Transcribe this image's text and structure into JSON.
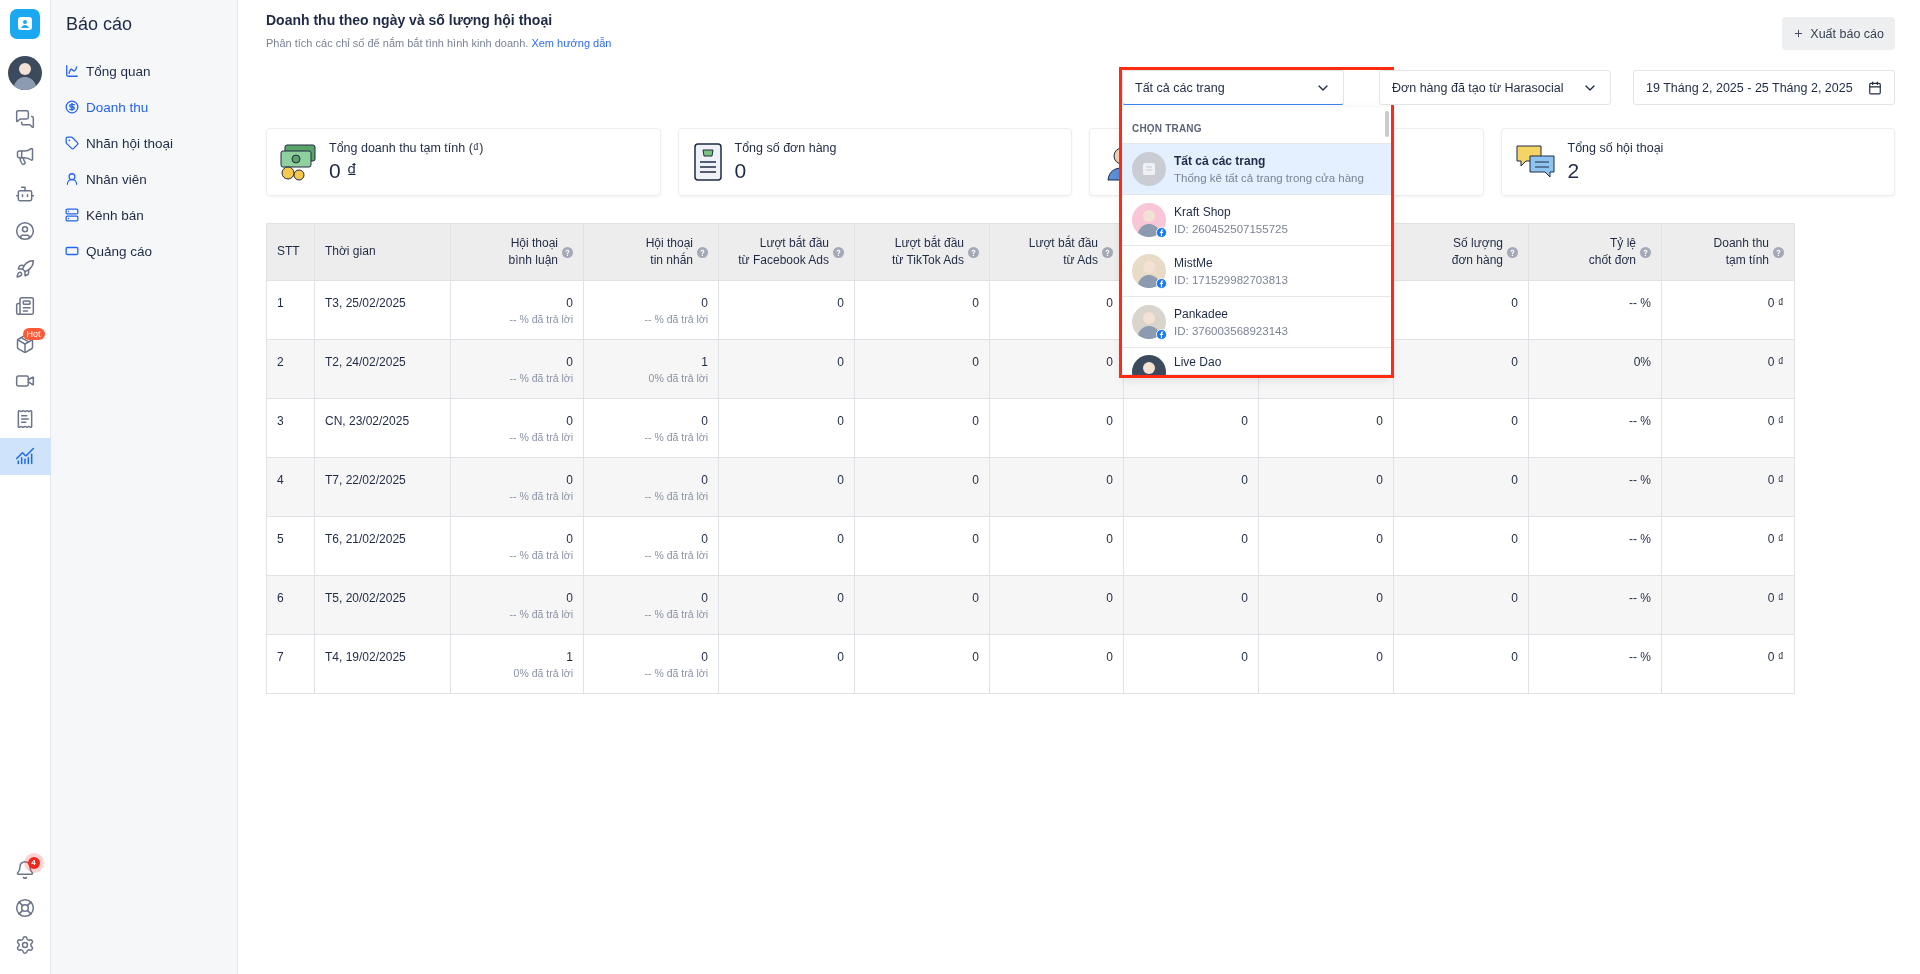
{
  "rail": {
    "items": [
      {
        "kind": "chat",
        "selected": false
      },
      {
        "kind": "megaphone",
        "selected": false
      },
      {
        "kind": "bot",
        "selected": false
      },
      {
        "kind": "user",
        "selected": false
      },
      {
        "kind": "rocket",
        "selected": false
      },
      {
        "kind": "news",
        "selected": false
      },
      {
        "kind": "box",
        "selected": false,
        "badge": "Hot"
      },
      {
        "kind": "live",
        "selected": false
      },
      {
        "kind": "invoice",
        "selected": false
      },
      {
        "kind": "chart",
        "selected": true
      }
    ],
    "bottom": [
      {
        "kind": "bell",
        "badge": "4"
      },
      {
        "kind": "help"
      },
      {
        "kind": "settings"
      }
    ]
  },
  "sidebar": {
    "title": "Báo cáo",
    "items": [
      {
        "kind": "overview",
        "label": "Tổng quan",
        "selected": false
      },
      {
        "kind": "revenue",
        "label": "Doanh thu",
        "selected": true
      },
      {
        "kind": "tag",
        "label": "Nhãn hội thoại",
        "selected": false
      },
      {
        "kind": "staff",
        "label": "Nhân viên",
        "selected": false
      },
      {
        "kind": "channel",
        "label": "Kênh bán",
        "selected": false
      },
      {
        "kind": "ads",
        "label": "Quảng cáo",
        "selected": false
      }
    ]
  },
  "header": {
    "title": "Doanh thu theo ngày và số lượng hội thoại",
    "subtitle": "Phân tích các chỉ số để nắm bắt tình hình kinh doanh.",
    "link": "Xem hướng dẫn",
    "export_button": "Xuất báo cáo"
  },
  "filters": {
    "page_select": "Tất cả các trang",
    "order_select": "Đơn hàng đã tạo từ Harasocial",
    "date_range": "19 Tháng 2, 2025 - 25 Tháng 2, 2025"
  },
  "page_menu": {
    "heading": "CHỌN TRANG",
    "items": [
      {
        "kind": "all",
        "name": "Tất cả các trang",
        "detail": "Thống kê tất cả trang trong cửa hàng",
        "selected": true
      },
      {
        "kind": "page",
        "name": "Kraft Shop",
        "detail": "ID: 260452507155725",
        "selected": false
      },
      {
        "kind": "page",
        "name": "MistMe",
        "detail": "ID: 171529982703813",
        "selected": false
      },
      {
        "kind": "page",
        "name": "Pankadee",
        "detail": "ID: 376003568923143",
        "selected": false
      },
      {
        "kind": "page",
        "name": "Live Dao",
        "selected": false
      }
    ]
  },
  "stat_cards": [
    {
      "kind": "money",
      "label": "Tổng doanh thu tạm tính (₫)",
      "value": "0 ₫"
    },
    {
      "kind": "orders",
      "label": "Tổng số đơn hàng",
      "value": "0"
    },
    {
      "kind": "staff"
    },
    {
      "kind": "chat",
      "label": "Tổng số hội thoại",
      "value": "2"
    }
  ],
  "table": {
    "columns": [
      {
        "label": "STT",
        "help": false
      },
      {
        "label": "Thời gian",
        "help": false
      },
      {
        "label": "Hội thoại\nbình luận",
        "help": true
      },
      {
        "label": "Hội thoại\ntin nhắn",
        "help": true
      },
      {
        "label": "Lượt bắt đầu\ntừ Facebook Ads",
        "help": true
      },
      {
        "label": "Lượt bắt đầu\ntừ TikTok Ads",
        "help": true
      },
      {
        "label": "Lượt bắt đầu\ntừ Ads",
        "help": true
      },
      {},
      {},
      {
        "label": "Số lượng\nđơn hàng",
        "help": true
      },
      {
        "label": "Tỷ lệ\nchốt đơn",
        "help": true
      },
      {
        "label": "Doanh thu\ntạm tính",
        "help": true
      }
    ],
    "rows": [
      {
        "stt": "1",
        "time": "T3, 25/02/2025",
        "comments": {
          "value": "0",
          "note": "-- % đã trả lời"
        },
        "messages": {
          "value": "0",
          "note": "-- % đã trả lời"
        },
        "values": [
          "0",
          "0",
          "0",
          "0",
          "-- %",
          "0 ₫"
        ]
      },
      {
        "stt": "2",
        "time": "T2, 24/02/2025",
        "comments": {
          "value": "0",
          "note": "-- % đã trả lời"
        },
        "messages": {
          "value": "1",
          "note": "0% đã trả lời"
        },
        "values": [
          "0",
          "0",
          "0",
          "0",
          "0%",
          "0 ₫"
        ]
      },
      {
        "stt": "3",
        "time": "CN, 23/02/2025",
        "comments": {
          "value": "0",
          "note": "-- % đã trả lời"
        },
        "messages": {
          "value": "0",
          "note": "-- % đã trả lời"
        },
        "values": [
          "0",
          "0",
          "0",
          "0",
          "0",
          "0",
          "-- %",
          "0 ₫"
        ]
      },
      {
        "stt": "4",
        "time": "T7, 22/02/2025",
        "comments": {
          "value": "0",
          "note": "-- % đã trả lời"
        },
        "messages": {
          "value": "0",
          "note": "-- % đã trả lời"
        },
        "values": [
          "0",
          "0",
          "0",
          "0",
          "0",
          "0",
          "-- %",
          "0 ₫"
        ]
      },
      {
        "stt": "5",
        "time": "T6, 21/02/2025",
        "comments": {
          "value": "0",
          "note": "-- % đã trả lời"
        },
        "messages": {
          "value": "0",
          "note": "-- % đã trả lời"
        },
        "values": [
          "0",
          "0",
          "0",
          "0",
          "0",
          "0",
          "-- %",
          "0 ₫"
        ]
      },
      {
        "stt": "6",
        "time": "T5, 20/02/2025",
        "comments": {
          "value": "0",
          "note": "-- % đã trả lời"
        },
        "messages": {
          "value": "0",
          "note": "-- % đã trả lời"
        },
        "values": [
          "0",
          "0",
          "0",
          "0",
          "0",
          "0",
          "-- %",
          "0 ₫"
        ]
      },
      {
        "stt": "7",
        "time": "T4, 19/02/2025",
        "comments": {
          "value": "1",
          "note": "0% đã trả lời"
        },
        "messages": {
          "value": "0",
          "note": "-- % đã trả lời"
        },
        "values": [
          "0",
          "0",
          "0",
          "0",
          "0",
          "0",
          "-- %",
          "0 ₫"
        ]
      }
    ]
  }
}
